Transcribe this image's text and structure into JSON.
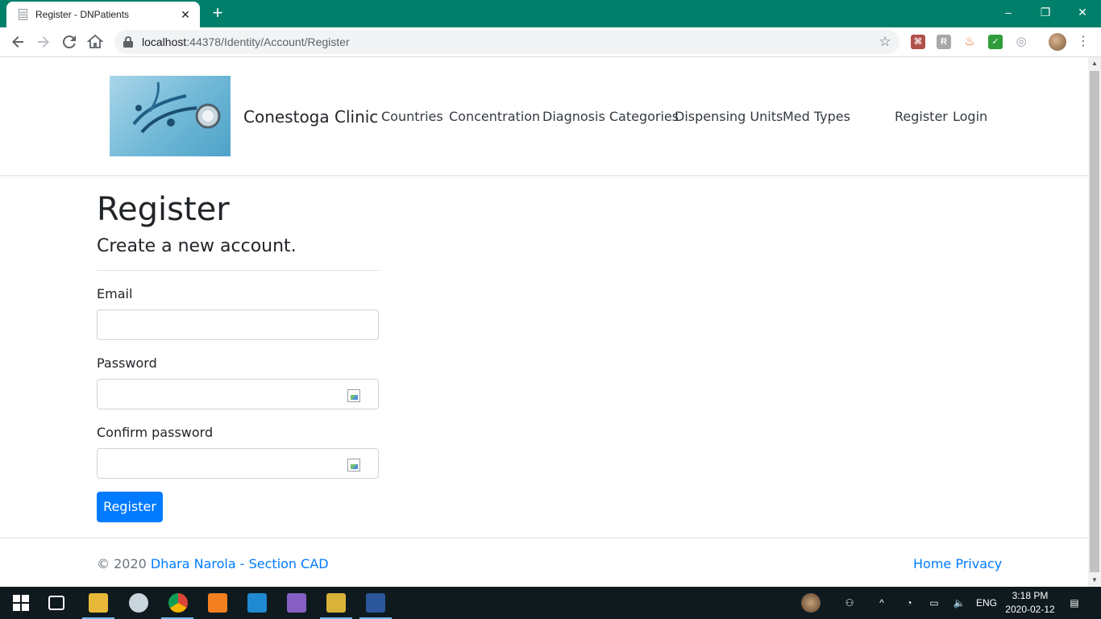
{
  "browser": {
    "tab_title": "Register - DNPatients",
    "tab_close": "✕",
    "new_tab": "+",
    "url_host": "localhost",
    "url_rest": ":44378/Identity/Account/Register",
    "window_controls": {
      "minimize": "–",
      "restore": "❐",
      "close": "✕"
    }
  },
  "header": {
    "brand": "Conestoga Clinic",
    "nav": [
      "Countries",
      "Concentration",
      "Diagnosis Categories",
      "Dispensing Units",
      "Med Types"
    ],
    "auth": {
      "register": "Register",
      "login": "Login"
    }
  },
  "form": {
    "title": "Register",
    "subtitle": "Create a new account.",
    "email_label": "Email",
    "password_label": "Password",
    "confirm_label": "Confirm password",
    "submit_label": "Register",
    "email_value": "",
    "password_value": "",
    "confirm_value": ""
  },
  "footer": {
    "copyright": "© 2020",
    "author_link": "Dhara Narola - Section CAD",
    "home_link": "Home",
    "privacy_link": "Privacy"
  },
  "taskbar": {
    "language": "ENG",
    "time": "3:18 PM",
    "date": "2020-02-12"
  },
  "colors": {
    "tab_strip": "#00806b",
    "primary": "#007bff",
    "taskbar": "#0f1a1f"
  }
}
